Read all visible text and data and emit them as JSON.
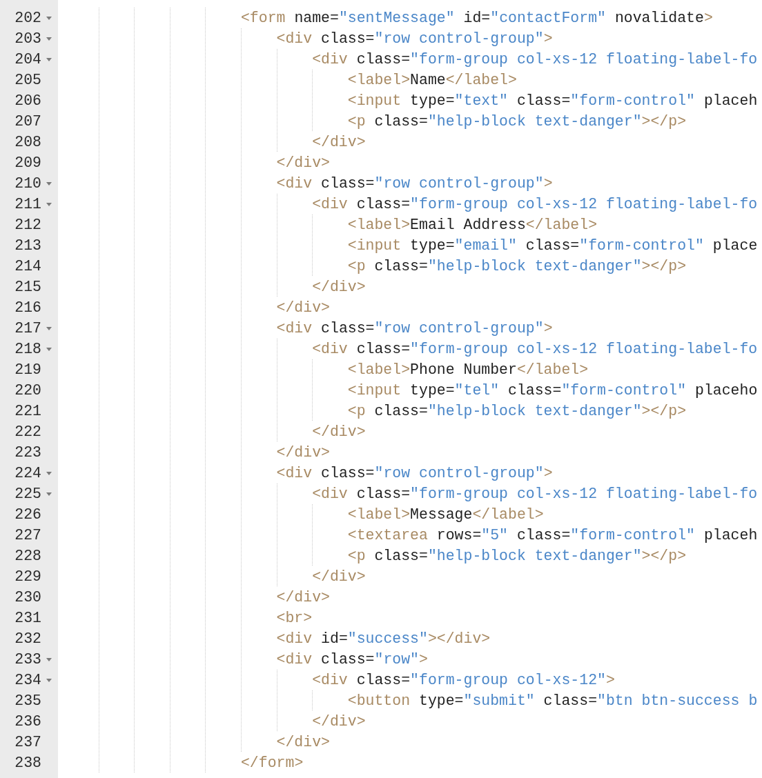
{
  "editor": {
    "lines": [
      {
        "number": "202",
        "expanded": true,
        "tokens": [
          {
            "kind": "tag",
            "text": "<form"
          },
          {
            "kind": "plain",
            "text": " name="
          },
          {
            "kind": "string",
            "text": "\"sentMessage\""
          },
          {
            "kind": "plain",
            "text": " id="
          },
          {
            "kind": "string",
            "text": "\"contactForm\""
          },
          {
            "kind": "plain",
            "text": " novalidate"
          },
          {
            "kind": "tag",
            "text": ">"
          }
        ],
        "children": [
          {
            "number": "203",
            "expanded": true,
            "tokens": [
              {
                "kind": "tag",
                "text": "<div"
              },
              {
                "kind": "plain",
                "text": " class="
              },
              {
                "kind": "string",
                "text": "\"row control-group\""
              },
              {
                "kind": "tag",
                "text": ">"
              }
            ],
            "children": [
              {
                "number": "204",
                "expanded": true,
                "tokens": [
                  {
                    "kind": "tag",
                    "text": "<div"
                  },
                  {
                    "kind": "plain",
                    "text": " class="
                  },
                  {
                    "kind": "string",
                    "text": "\"form-group col-xs-12 floating-label-fo"
                  }
                ],
                "children": [
                  {
                    "number": "205",
                    "tokens": [
                      {
                        "kind": "tag",
                        "text": "<label>"
                      },
                      {
                        "kind": "plain",
                        "text": "Name"
                      },
                      {
                        "kind": "tag",
                        "text": "</label>"
                      }
                    ]
                  },
                  {
                    "number": "206",
                    "tokens": [
                      {
                        "kind": "tag",
                        "text": "<input"
                      },
                      {
                        "kind": "plain",
                        "text": " type="
                      },
                      {
                        "kind": "string",
                        "text": "\"text\""
                      },
                      {
                        "kind": "plain",
                        "text": " class="
                      },
                      {
                        "kind": "string",
                        "text": "\"form-control\""
                      },
                      {
                        "kind": "plain",
                        "text": " placeh"
                      }
                    ]
                  },
                  {
                    "number": "207",
                    "tokens": [
                      {
                        "kind": "tag",
                        "text": "<p"
                      },
                      {
                        "kind": "plain",
                        "text": " class="
                      },
                      {
                        "kind": "string",
                        "text": "\"help-block text-danger\""
                      },
                      {
                        "kind": "tag",
                        "text": "></p>"
                      }
                    ]
                  }
                ]
              },
              {
                "number": "208",
                "tokens": [
                  {
                    "kind": "tag",
                    "text": "</div>"
                  }
                ]
              }
            ]
          },
          {
            "number": "209",
            "tokens": [
              {
                "kind": "tag",
                "text": "</div>"
              }
            ]
          },
          {
            "number": "210",
            "expanded": true,
            "tokens": [
              {
                "kind": "tag",
                "text": "<div"
              },
              {
                "kind": "plain",
                "text": " class="
              },
              {
                "kind": "string",
                "text": "\"row control-group\""
              },
              {
                "kind": "tag",
                "text": ">"
              }
            ],
            "children": [
              {
                "number": "211",
                "expanded": true,
                "tokens": [
                  {
                    "kind": "tag",
                    "text": "<div"
                  },
                  {
                    "kind": "plain",
                    "text": " class="
                  },
                  {
                    "kind": "string",
                    "text": "\"form-group col-xs-12 floating-label-fo"
                  }
                ],
                "children": [
                  {
                    "number": "212",
                    "tokens": [
                      {
                        "kind": "tag",
                        "text": "<label>"
                      },
                      {
                        "kind": "plain",
                        "text": "Email Address"
                      },
                      {
                        "kind": "tag",
                        "text": "</label>"
                      }
                    ]
                  },
                  {
                    "number": "213",
                    "tokens": [
                      {
                        "kind": "tag",
                        "text": "<input"
                      },
                      {
                        "kind": "plain",
                        "text": " type="
                      },
                      {
                        "kind": "string",
                        "text": "\"email\""
                      },
                      {
                        "kind": "plain",
                        "text": " class="
                      },
                      {
                        "kind": "string",
                        "text": "\"form-control\""
                      },
                      {
                        "kind": "plain",
                        "text": " place"
                      }
                    ]
                  },
                  {
                    "number": "214",
                    "tokens": [
                      {
                        "kind": "tag",
                        "text": "<p"
                      },
                      {
                        "kind": "plain",
                        "text": " class="
                      },
                      {
                        "kind": "string",
                        "text": "\"help-block text-danger\""
                      },
                      {
                        "kind": "tag",
                        "text": "></p>"
                      }
                    ]
                  }
                ]
              },
              {
                "number": "215",
                "tokens": [
                  {
                    "kind": "tag",
                    "text": "</div>"
                  }
                ]
              }
            ]
          },
          {
            "number": "216",
            "tokens": [
              {
                "kind": "tag",
                "text": "</div>"
              }
            ]
          },
          {
            "number": "217",
            "expanded": true,
            "tokens": [
              {
                "kind": "tag",
                "text": "<div"
              },
              {
                "kind": "plain",
                "text": " class="
              },
              {
                "kind": "string",
                "text": "\"row control-group\""
              },
              {
                "kind": "tag",
                "text": ">"
              }
            ],
            "children": [
              {
                "number": "218",
                "expanded": true,
                "tokens": [
                  {
                    "kind": "tag",
                    "text": "<div"
                  },
                  {
                    "kind": "plain",
                    "text": " class="
                  },
                  {
                    "kind": "string",
                    "text": "\"form-group col-xs-12 floating-label-fo"
                  }
                ],
                "children": [
                  {
                    "number": "219",
                    "tokens": [
                      {
                        "kind": "tag",
                        "text": "<label>"
                      },
                      {
                        "kind": "plain",
                        "text": "Phone Number"
                      },
                      {
                        "kind": "tag",
                        "text": "</label>"
                      }
                    ]
                  },
                  {
                    "number": "220",
                    "tokens": [
                      {
                        "kind": "tag",
                        "text": "<input"
                      },
                      {
                        "kind": "plain",
                        "text": " type="
                      },
                      {
                        "kind": "string",
                        "text": "\"tel\""
                      },
                      {
                        "kind": "plain",
                        "text": " class="
                      },
                      {
                        "kind": "string",
                        "text": "\"form-control\""
                      },
                      {
                        "kind": "plain",
                        "text": " placeho"
                      }
                    ]
                  },
                  {
                    "number": "221",
                    "tokens": [
                      {
                        "kind": "tag",
                        "text": "<p"
                      },
                      {
                        "kind": "plain",
                        "text": " class="
                      },
                      {
                        "kind": "string",
                        "text": "\"help-block text-danger\""
                      },
                      {
                        "kind": "tag",
                        "text": "></p>"
                      }
                    ]
                  }
                ]
              },
              {
                "number": "222",
                "tokens": [
                  {
                    "kind": "tag",
                    "text": "</div>"
                  }
                ]
              }
            ]
          },
          {
            "number": "223",
            "tokens": [
              {
                "kind": "tag",
                "text": "</div>"
              }
            ]
          },
          {
            "number": "224",
            "expanded": true,
            "tokens": [
              {
                "kind": "tag",
                "text": "<div"
              },
              {
                "kind": "plain",
                "text": " class="
              },
              {
                "kind": "string",
                "text": "\"row control-group\""
              },
              {
                "kind": "tag",
                "text": ">"
              }
            ],
            "children": [
              {
                "number": "225",
                "expanded": true,
                "tokens": [
                  {
                    "kind": "tag",
                    "text": "<div"
                  },
                  {
                    "kind": "plain",
                    "text": " class="
                  },
                  {
                    "kind": "string",
                    "text": "\"form-group col-xs-12 floating-label-fo"
                  }
                ],
                "children": [
                  {
                    "number": "226",
                    "tokens": [
                      {
                        "kind": "tag",
                        "text": "<label>"
                      },
                      {
                        "kind": "plain",
                        "text": "Message"
                      },
                      {
                        "kind": "tag",
                        "text": "</label>"
                      }
                    ]
                  },
                  {
                    "number": "227",
                    "tokens": [
                      {
                        "kind": "tag",
                        "text": "<textarea"
                      },
                      {
                        "kind": "plain",
                        "text": " rows="
                      },
                      {
                        "kind": "string",
                        "text": "\"5\""
                      },
                      {
                        "kind": "plain",
                        "text": " class="
                      },
                      {
                        "kind": "string",
                        "text": "\"form-control\""
                      },
                      {
                        "kind": "plain",
                        "text": " placeh"
                      }
                    ]
                  },
                  {
                    "number": "228",
                    "tokens": [
                      {
                        "kind": "tag",
                        "text": "<p"
                      },
                      {
                        "kind": "plain",
                        "text": " class="
                      },
                      {
                        "kind": "string",
                        "text": "\"help-block text-danger\""
                      },
                      {
                        "kind": "tag",
                        "text": "></p>"
                      }
                    ]
                  }
                ]
              },
              {
                "number": "229",
                "tokens": [
                  {
                    "kind": "tag",
                    "text": "</div>"
                  }
                ]
              }
            ]
          },
          {
            "number": "230",
            "tokens": [
              {
                "kind": "tag",
                "text": "</div>"
              }
            ]
          },
          {
            "number": "231",
            "tokens": [
              {
                "kind": "tag",
                "text": "<br>"
              }
            ]
          },
          {
            "number": "232",
            "tokens": [
              {
                "kind": "tag",
                "text": "<div"
              },
              {
                "kind": "plain",
                "text": " id="
              },
              {
                "kind": "string",
                "text": "\"success\""
              },
              {
                "kind": "tag",
                "text": "></div>"
              }
            ]
          },
          {
            "number": "233",
            "expanded": true,
            "tokens": [
              {
                "kind": "tag",
                "text": "<div"
              },
              {
                "kind": "plain",
                "text": " class="
              },
              {
                "kind": "string",
                "text": "\"row\""
              },
              {
                "kind": "tag",
                "text": ">"
              }
            ],
            "children": [
              {
                "number": "234",
                "expanded": true,
                "tokens": [
                  {
                    "kind": "tag",
                    "text": "<div"
                  },
                  {
                    "kind": "plain",
                    "text": " class="
                  },
                  {
                    "kind": "string",
                    "text": "\"form-group col-xs-12\""
                  },
                  {
                    "kind": "tag",
                    "text": ">"
                  }
                ],
                "children": [
                  {
                    "number": "235",
                    "tokens": [
                      {
                        "kind": "tag",
                        "text": "<button"
                      },
                      {
                        "kind": "plain",
                        "text": " type="
                      },
                      {
                        "kind": "string",
                        "text": "\"submit\""
                      },
                      {
                        "kind": "plain",
                        "text": " class="
                      },
                      {
                        "kind": "string",
                        "text": "\"btn btn-success b"
                      }
                    ]
                  }
                ]
              },
              {
                "number": "236",
                "tokens": [
                  {
                    "kind": "tag",
                    "text": "</div>"
                  }
                ]
              }
            ]
          },
          {
            "number": "237",
            "tokens": [
              {
                "kind": "tag",
                "text": "</div>"
              }
            ]
          }
        ]
      },
      {
        "number": "238",
        "tokens": [
          {
            "kind": "tag",
            "text": "</form>"
          }
        ]
      }
    ]
  }
}
